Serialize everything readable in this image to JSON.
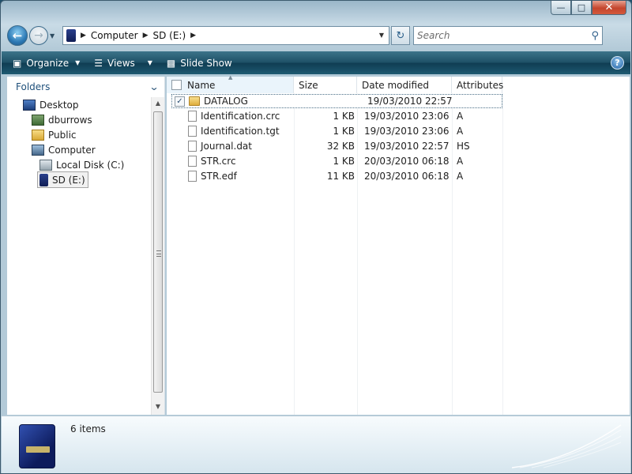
{
  "window": {
    "caption_buttons": [
      "minimize",
      "maximize",
      "close"
    ]
  },
  "address_bar": {
    "crumbs": [
      "Computer",
      "SD (E:)"
    ],
    "search_placeholder": "Search"
  },
  "command_bar": {
    "organize": "Organize",
    "views": "Views",
    "slideshow": "Slide Show",
    "help": "?"
  },
  "nav_pane": {
    "header": "Folders",
    "items": [
      {
        "label": "Desktop",
        "icon": "desktop-icon"
      },
      {
        "label": "dburrows",
        "icon": "user-folder-icon"
      },
      {
        "label": "Public",
        "icon": "folder-icon"
      },
      {
        "label": "Computer",
        "icon": "computer-icon"
      },
      {
        "label": "Local Disk (C:)",
        "icon": "hard-disk-icon"
      },
      {
        "label": "SD (E:)",
        "icon": "sd-card-icon"
      }
    ]
  },
  "file_list": {
    "columns": {
      "name": "Name",
      "size": "Size",
      "date": "Date modified",
      "attributes": "Attributes"
    },
    "rows": [
      {
        "name": "DATALOG",
        "size": "",
        "date": "19/03/2010 22:57",
        "attr": "",
        "type": "folder",
        "checked": true
      },
      {
        "name": "Identification.crc",
        "size": "1 KB",
        "date": "19/03/2010 23:06",
        "attr": "A",
        "type": "file"
      },
      {
        "name": "Identification.tgt",
        "size": "1 KB",
        "date": "19/03/2010 23:06",
        "attr": "A",
        "type": "file"
      },
      {
        "name": "Journal.dat",
        "size": "32 KB",
        "date": "19/03/2010 22:57",
        "attr": "HS",
        "type": "file"
      },
      {
        "name": "STR.crc",
        "size": "1 KB",
        "date": "20/03/2010 06:18",
        "attr": "A",
        "type": "file"
      },
      {
        "name": "STR.edf",
        "size": "11 KB",
        "date": "20/03/2010 06:18",
        "attr": "A",
        "type": "file"
      }
    ]
  },
  "details_pane": {
    "items_count": "6 items"
  }
}
